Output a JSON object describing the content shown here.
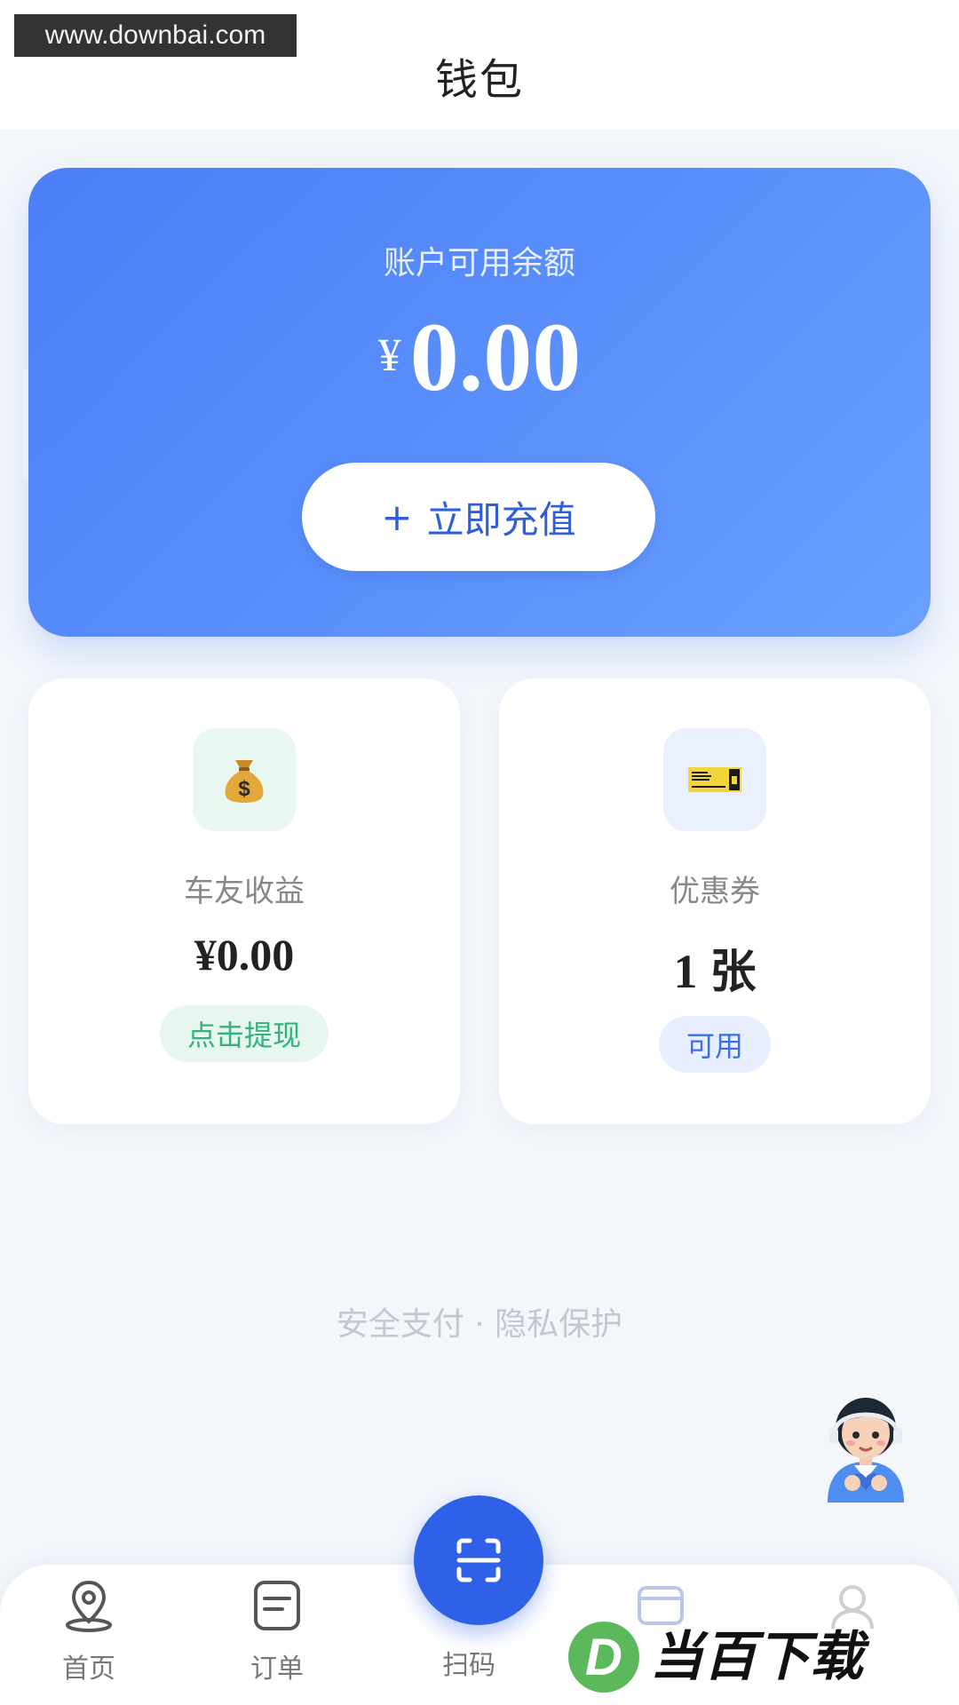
{
  "watermark": "www.downbai.com",
  "header": {
    "title": "钱包"
  },
  "balance": {
    "label": "账户可用余额",
    "currency": "¥",
    "amount": "0.00",
    "recharge_label": "立即充值",
    "recharge_icon": "plus-icon"
  },
  "cards": {
    "earnings": {
      "icon": "money-bag-icon",
      "title": "车友收益",
      "value": "¥0.00",
      "action": "点击提现"
    },
    "coupons": {
      "icon": "ticket-icon",
      "title": "优惠券",
      "count": "1",
      "unit": "张",
      "status": "可用"
    }
  },
  "footer_note": "安全支付 · 隐私保护",
  "tabbar": {
    "items": [
      {
        "label": "首页",
        "icon": "location-pin-icon"
      },
      {
        "label": "订单",
        "icon": "order-list-icon"
      },
      {
        "label": "扫码",
        "icon": "scan-icon"
      }
    ]
  },
  "brand": {
    "text": "当百下载"
  },
  "colors": {
    "primary": "#2f61e8",
    "card_gradient_start": "#4c7ff7",
    "card_gradient_end": "#6aa0ff",
    "green": "#33b27a",
    "page_bg": "#f3f6fb"
  }
}
